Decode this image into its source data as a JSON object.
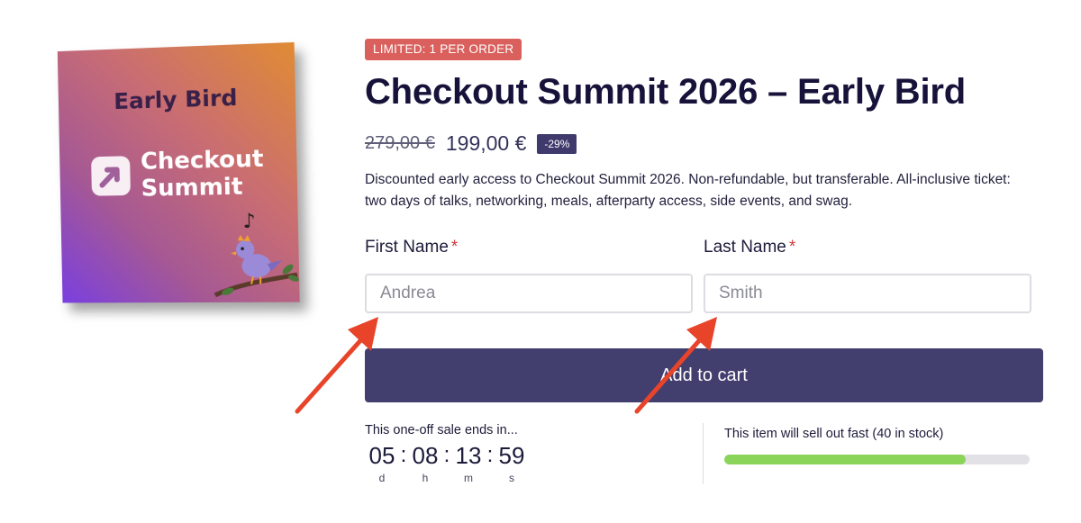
{
  "product": {
    "image": {
      "subtitle": "Early Bird",
      "brand_line1": "Checkout",
      "brand_line2": "Summit",
      "logo_icon": "arrow-up-right-icon",
      "decor_icon": "singing-bird-icon"
    },
    "limit_badge": "LIMITED: 1 PER ORDER",
    "title": "Checkout Summit 2026 – Early Bird",
    "price_old": "279,00 €",
    "price_new": "199,00 €",
    "discount": "-29%",
    "description": "Discounted early access to Checkout Summit 2026. Non-refundable, but transferable. All-inclusive ticket: two days of talks, networking, meals, afterparty access, side events, and swag."
  },
  "form": {
    "first_name_label": "First Name",
    "first_name_placeholder": "Andrea",
    "last_name_label": "Last Name",
    "last_name_placeholder": "Smith",
    "required_mark": "*",
    "add_to_cart_label": "Add to cart"
  },
  "countdown": {
    "label": "This one-off sale ends in...",
    "units": [
      {
        "value": "05",
        "letter": "d"
      },
      {
        "value": "08",
        "letter": "h"
      },
      {
        "value": "13",
        "letter": "m"
      },
      {
        "value": "59",
        "letter": "s"
      }
    ],
    "separator": ":"
  },
  "stock": {
    "label": "This item will sell out fast (40 in stock)",
    "fill_fraction": 0.79
  },
  "colors": {
    "badge_red": "#d9605c",
    "button_purple": "#423f6f",
    "stock_green": "#8bd45a",
    "arrow_red": "#e8442a"
  },
  "annotations": {
    "arrow_icon": "red-annotation-arrow-icon"
  }
}
